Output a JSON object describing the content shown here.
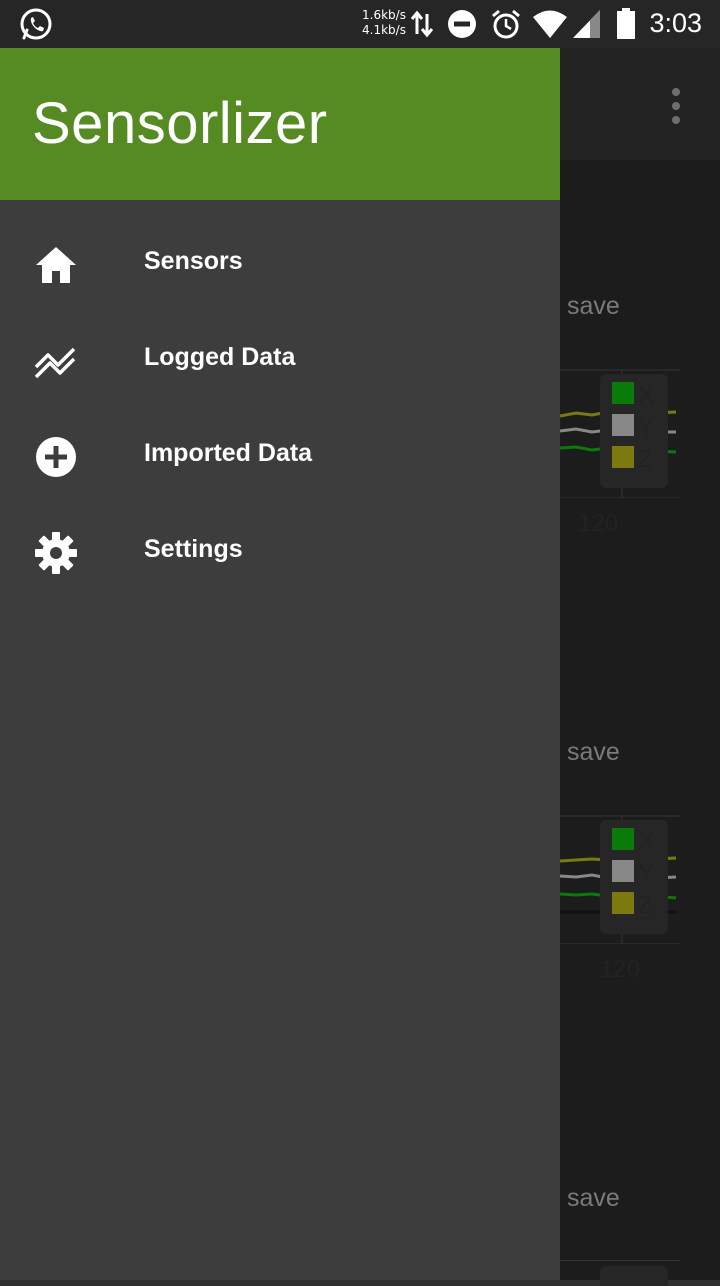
{
  "status_bar": {
    "notification_app_icon": "whatsapp-icon",
    "net_speed_up": "1.6kb/s",
    "net_speed_down": "4.1kb/s",
    "icons": [
      "data-transfer-icon",
      "dnd-icon",
      "alarm-icon",
      "wifi-icon",
      "cell-signal-icon",
      "battery-icon"
    ],
    "time": "3:03"
  },
  "drawer": {
    "title": "Sensorlizer",
    "header_color": "#558b22",
    "items": [
      {
        "label": "Sensors",
        "icon": "home-icon"
      },
      {
        "label": "Logged Data",
        "icon": "trending-icon"
      },
      {
        "label": "Imported Data",
        "icon": "add-circle-icon"
      },
      {
        "label": "Settings",
        "icon": "gear-icon"
      }
    ]
  },
  "background": {
    "save_labels": [
      "save",
      "save",
      "save"
    ],
    "charts": [
      {
        "legend": [
          "X",
          "Y",
          "Z"
        ],
        "tick": "120"
      },
      {
        "legend": [
          "X",
          "Y",
          "Z"
        ],
        "tick": "120"
      }
    ],
    "series_colors": {
      "X": "#0a7a0a",
      "Y": "#888888",
      "Z": "#7a7a10"
    }
  }
}
